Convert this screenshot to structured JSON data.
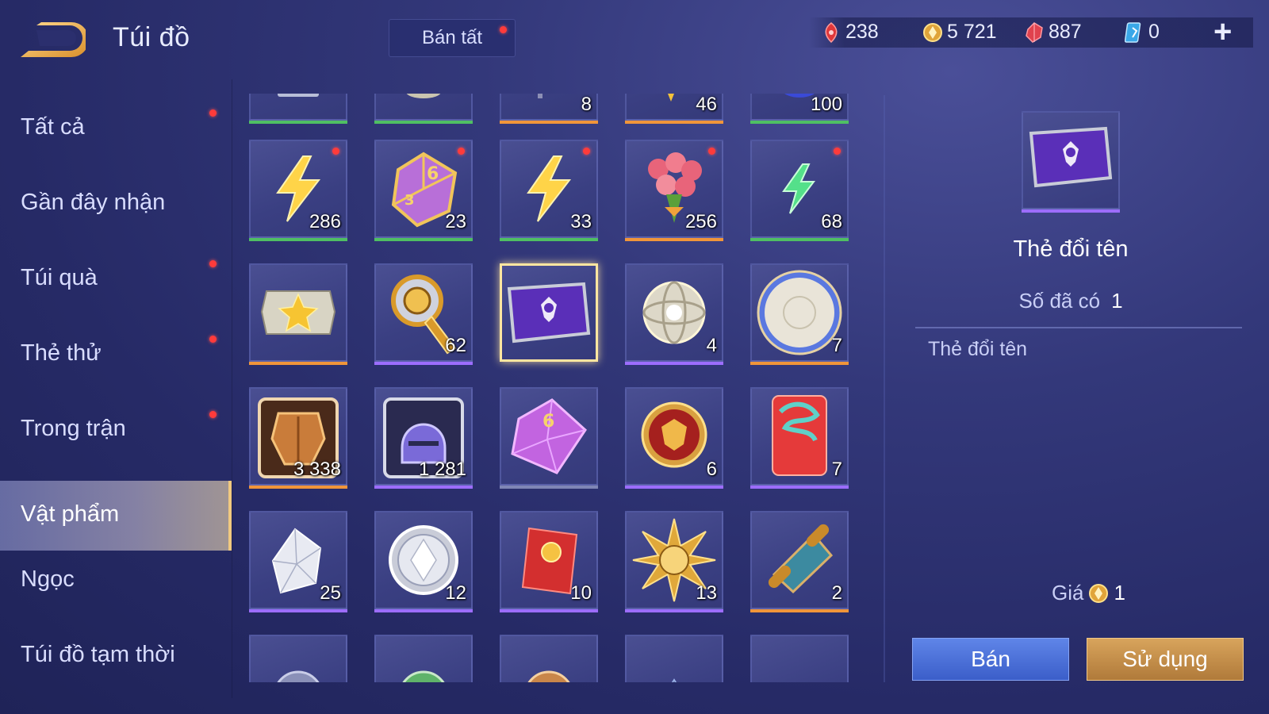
{
  "header": {
    "title": "Túi đồ",
    "sell_all_label": "Bán tất",
    "currencies": [
      {
        "icon": "red-token-icon",
        "value": "238"
      },
      {
        "icon": "gold-coin-icon",
        "value": "5 721"
      },
      {
        "icon": "ruby-gem-icon",
        "value": "887"
      },
      {
        "icon": "blue-card-icon",
        "value": "0"
      }
    ],
    "plus_label": "+"
  },
  "sidebar": {
    "items": [
      {
        "label": "Tất cả",
        "dot": true,
        "active": false
      },
      {
        "label": "Gần đây nhận",
        "dot": false,
        "active": false
      },
      {
        "label": "Túi quà",
        "dot": true,
        "active": false
      },
      {
        "label": "Thẻ thử",
        "dot": true,
        "active": false
      },
      {
        "label": "Trong trận",
        "dot": true,
        "active": false
      },
      {
        "label": "Vật phẩm",
        "dot": false,
        "active": true
      },
      {
        "label": "Ngọc",
        "dot": false,
        "active": false
      },
      {
        "label": "Túi đồ tạm thời",
        "dot": false,
        "active": false
      }
    ]
  },
  "grid": {
    "rows": [
      [
        {
          "icon": "partial-item-icon",
          "count": "",
          "rarity": "green"
        },
        {
          "icon": "partial-item-icon",
          "count": "",
          "rarity": "green"
        },
        {
          "icon": "partial-item-icon",
          "count": "8",
          "rarity": "orange"
        },
        {
          "icon": "partial-item-icon",
          "count": "46",
          "rarity": "orange"
        },
        {
          "icon": "partial-item-icon",
          "count": "100",
          "rarity": "green"
        }
      ],
      [
        {
          "icon": "gold-lightning-icon",
          "count": "286",
          "rarity": "green",
          "dot": true
        },
        {
          "icon": "dice-icon",
          "count": "23",
          "rarity": "green",
          "dot": true
        },
        {
          "icon": "gold-lightning-icon",
          "count": "33",
          "rarity": "green",
          "dot": true
        },
        {
          "icon": "rose-bouquet-icon",
          "count": "256",
          "rarity": "orange",
          "dot": true
        },
        {
          "icon": "green-lightning-icon",
          "count": "68",
          "rarity": "green",
          "dot": true
        }
      ],
      [
        {
          "icon": "star-ticket-icon",
          "count": "",
          "rarity": "orange"
        },
        {
          "icon": "golden-spyglass-icon",
          "count": "62",
          "rarity": "purple"
        },
        {
          "icon": "rename-card-icon",
          "count": "",
          "rarity": "purple",
          "selected": true
        },
        {
          "icon": "silver-orb-icon",
          "count": "4",
          "rarity": "purple"
        },
        {
          "icon": "white-disc-icon",
          "count": "7",
          "rarity": "orange"
        }
      ],
      [
        {
          "icon": "armor-fragment-icon",
          "count": "3 338",
          "rarity": "orange"
        },
        {
          "icon": "helmet-fragment-icon",
          "count": "1 281",
          "rarity": "purple"
        },
        {
          "icon": "purple-dice-icon",
          "count": "",
          "rarity": "grey"
        },
        {
          "icon": "tiger-medal-icon",
          "count": "6",
          "rarity": "purple"
        },
        {
          "icon": "red-envelope-icon",
          "count": "7",
          "rarity": "purple"
        }
      ],
      [
        {
          "icon": "diamond-icon",
          "count": "25",
          "rarity": "purple"
        },
        {
          "icon": "silver-coin-icon",
          "count": "12",
          "rarity": "purple"
        },
        {
          "icon": "red-packet-icon",
          "count": "10",
          "rarity": "purple"
        },
        {
          "icon": "sun-emblem-icon",
          "count": "13",
          "rarity": "purple"
        },
        {
          "icon": "scroll-icon",
          "count": "2",
          "rarity": "orange"
        }
      ],
      [
        {
          "icon": "partial-item-icon",
          "count": "",
          "rarity": "none"
        },
        {
          "icon": "partial-item-icon",
          "count": "",
          "rarity": "none"
        },
        {
          "icon": "partial-item-icon",
          "count": "",
          "rarity": "none"
        },
        {
          "icon": "partial-item-icon",
          "count": "",
          "rarity": "none"
        },
        {
          "icon": "partial-item-icon",
          "count": "",
          "rarity": "none"
        }
      ]
    ]
  },
  "detail": {
    "icon": "rename-card-icon",
    "name": "Thẻ đổi tên",
    "owned_label": "Số đã có",
    "owned_value": "1",
    "description": "Thẻ đổi tên",
    "price_label": "Giá",
    "price_value": "1",
    "sell_label": "Bán",
    "use_label": "Sử dụng"
  },
  "colors": {
    "green": "#4fbf63",
    "orange": "#f0953a",
    "purple": "#9c6dff",
    "grey": "#7f86b5",
    "dot": "#ff3b3b",
    "accent": "#f1c980"
  }
}
